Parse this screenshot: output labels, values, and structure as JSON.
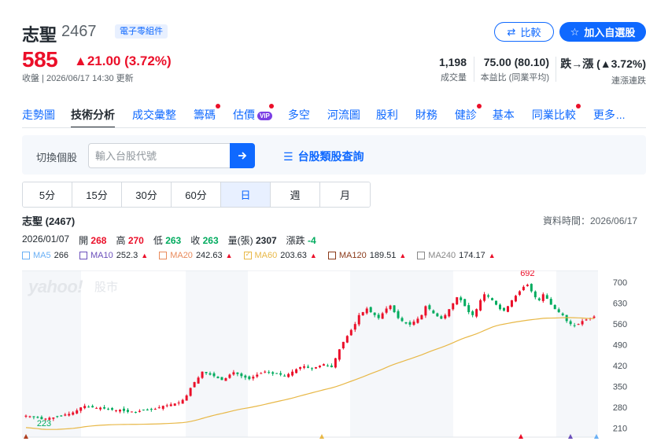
{
  "stock": {
    "name": "志聖",
    "code": "2467",
    "category": "電子零組件",
    "price": "585",
    "change": "▲21.00 (3.72%)",
    "meta": "收盤 | 2026/06/17 14:30 更新"
  },
  "actions": {
    "compare": "比較",
    "watchlist": "加入自選股"
  },
  "stats": [
    {
      "value": "1,198",
      "label": "成交量"
    },
    {
      "value": "75.00 (80.10)",
      "label": "本益比 (同業平均)"
    },
    {
      "value": "跌→漲 (▲3.72%)",
      "label": "連漲連跌"
    }
  ],
  "tabs": [
    {
      "label": "走勢圖",
      "dot": false
    },
    {
      "label": "技術分析",
      "dot": false,
      "active": true
    },
    {
      "label": "成交彙整",
      "dot": false
    },
    {
      "label": "籌碼",
      "dot": true
    },
    {
      "label": "估價",
      "dot": true,
      "vip": "VIP"
    },
    {
      "label": "多空",
      "dot": false
    },
    {
      "label": "河流圖",
      "dot": false
    },
    {
      "label": "股利",
      "dot": false
    },
    {
      "label": "財務",
      "dot": false
    },
    {
      "label": "健診",
      "dot": true
    },
    {
      "label": "基本",
      "dot": false
    },
    {
      "label": "同業比較",
      "dot": true
    },
    {
      "label": "更多",
      "dot": false
    }
  ],
  "search": {
    "label": "切換個股",
    "placeholder": "輸入台股代號",
    "category_link": "台股類股查詢"
  },
  "intervals": [
    "5分",
    "15分",
    "30分",
    "60分",
    "日",
    "週",
    "月"
  ],
  "selected_interval": "日",
  "chart_header": {
    "title": "志聖 (2467)",
    "data_time": "資料時間：2026/06/17"
  },
  "ohlc": {
    "date": "2026/01/07",
    "open_label": "開",
    "open": "268",
    "high_label": "高",
    "high": "270",
    "low_label": "低",
    "low": "263",
    "close_label": "收",
    "close": "263",
    "vol_label": "量(張)",
    "vol": "2307",
    "chg_label": "漲跌",
    "chg": "-4"
  },
  "ma": [
    {
      "name": "MA5",
      "value": "266",
      "color": "#6ab0f5",
      "up": false
    },
    {
      "name": "MA10",
      "value": "252.3",
      "color": "#6b4fbb",
      "up": true
    },
    {
      "name": "MA20",
      "value": "242.63",
      "color": "#e98b5c",
      "up": true
    },
    {
      "name": "MA60",
      "value": "203.63",
      "color": "#e8b847",
      "up": true,
      "checked": true
    },
    {
      "name": "MA120",
      "value": "189.51",
      "color": "#8b3a1a",
      "up": true
    },
    {
      "name": "MA240",
      "value": "174.17",
      "color": "#888888",
      "up": true
    }
  ],
  "watermark": {
    "logo": "yahoo!",
    "text": "股市"
  },
  "chart_data": {
    "type": "candlestick",
    "y_ticks": [
      700,
      630,
      560,
      490,
      420,
      350,
      280,
      210
    ],
    "ylim": [
      180,
      740
    ],
    "max_label": "692",
    "min_label": "223",
    "closes": [
      252,
      250,
      247,
      245,
      240,
      242,
      245,
      246,
      248,
      252,
      256,
      258,
      263,
      270,
      280,
      285,
      282,
      280,
      278,
      279,
      276,
      274,
      272,
      270,
      272,
      268,
      265,
      266,
      263,
      268,
      272,
      270,
      272,
      275,
      280,
      285,
      287,
      290,
      293,
      296,
      305,
      320,
      345,
      365,
      380,
      400,
      395,
      390,
      385,
      378,
      372,
      378,
      390,
      398,
      392,
      385,
      380,
      375,
      383,
      390,
      395,
      400,
      398,
      393,
      395,
      390,
      385,
      392,
      400,
      408,
      415,
      418,
      413,
      410,
      415,
      420,
      425,
      420,
      415,
      445,
      475,
      500,
      520,
      540,
      560,
      590,
      600,
      612,
      600,
      590,
      580,
      596,
      612,
      622,
      600,
      580,
      570,
      562,
      558,
      568,
      578,
      590,
      620,
      610,
      596,
      586,
      578,
      590,
      610,
      630,
      650,
      640,
      620,
      600,
      590,
      610,
      640,
      660,
      652,
      640,
      625,
      610,
      605,
      620,
      640,
      655,
      670,
      685,
      692,
      670,
      650,
      640,
      660,
      645,
      625,
      610,
      600,
      590,
      570,
      560,
      555,
      560,
      570,
      575,
      580,
      585
    ]
  },
  "colors": {
    "up": "#eb0f29",
    "down": "#00ab5e",
    "accent": "#0f69ff"
  }
}
